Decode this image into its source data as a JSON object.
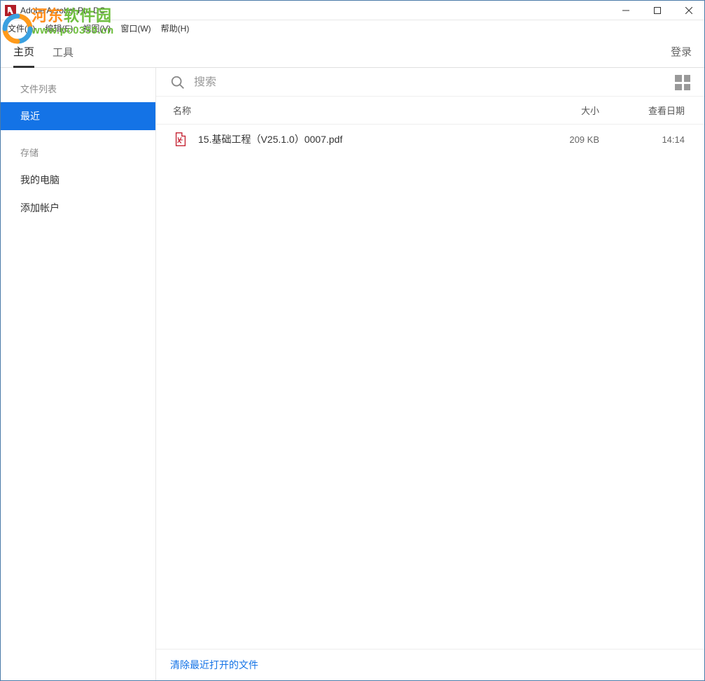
{
  "app": {
    "title": "Adobe Acrobat Pro DC"
  },
  "menu": {
    "file": "文件(F)",
    "edit": "编辑(E)",
    "view": "视图(V)",
    "window": "窗口(W)",
    "help": "帮助(H)"
  },
  "watermark": {
    "text_a": "河东",
    "text_b": "软件园",
    "url": "www.pc0359.cn"
  },
  "tabs": {
    "home": "主页",
    "tools": "工具",
    "login": "登录"
  },
  "sidebar": {
    "section_files": "文件列表",
    "recent": "最近",
    "section_storage": "存储",
    "my_computer": "我的电脑",
    "add_account": "添加帐户"
  },
  "search": {
    "placeholder": "搜索"
  },
  "columns": {
    "name": "名称",
    "size": "大小",
    "date": "查看日期"
  },
  "files": [
    {
      "name": "15.基础工程（V25.1.0）0007.pdf",
      "size": "209 KB",
      "date": "14:14"
    }
  ],
  "footer": {
    "clear_recent": "清除最近打开的文件"
  },
  "center_wm": ""
}
